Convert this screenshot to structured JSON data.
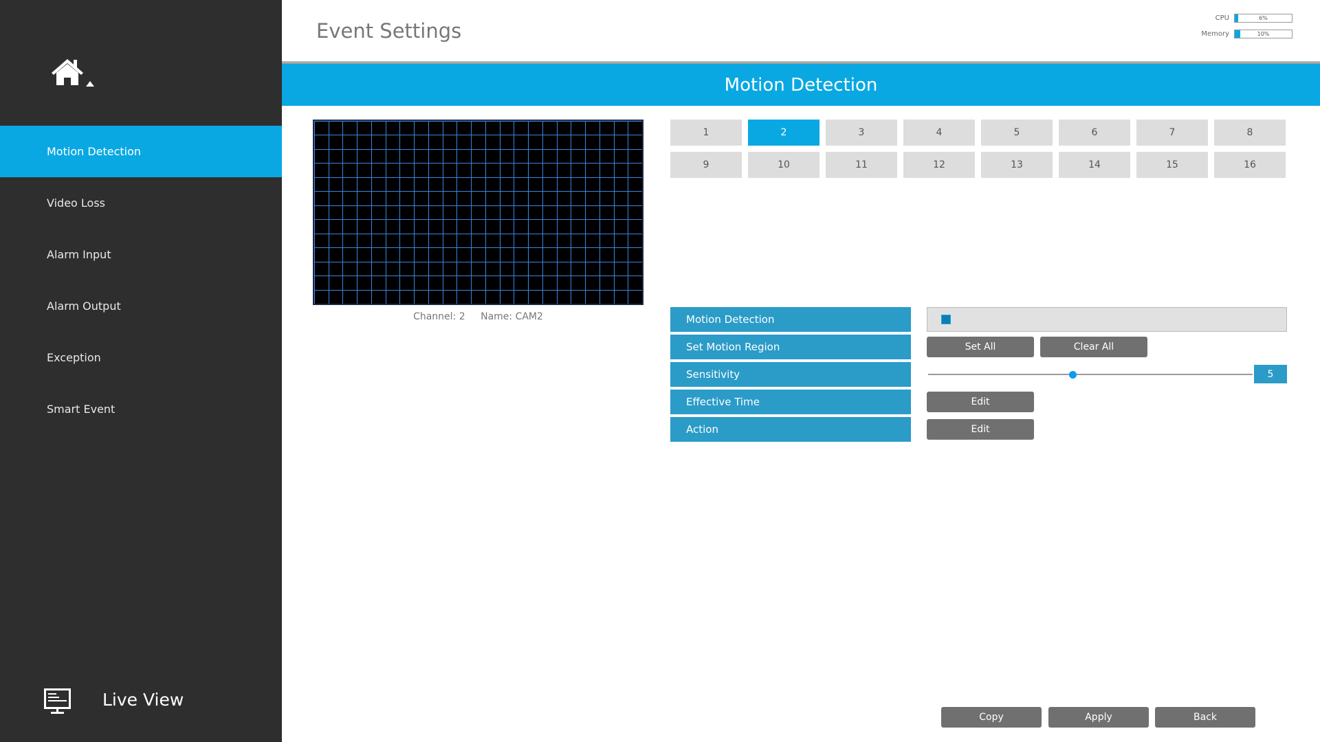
{
  "sidebar": {
    "home_icon": "home-icon",
    "items": [
      {
        "label": "Motion Detection",
        "active": true
      },
      {
        "label": "Video Loss",
        "active": false
      },
      {
        "label": "Alarm Input",
        "active": false
      },
      {
        "label": "Alarm Output",
        "active": false
      },
      {
        "label": "Exception",
        "active": false
      },
      {
        "label": "Smart Event",
        "active": false
      }
    ],
    "live_view": {
      "label": "Live View",
      "icon": "monitor-icon"
    }
  },
  "header": {
    "title": "Event Settings",
    "resources": {
      "cpu": {
        "label": "CPU",
        "value": "6%",
        "percent": 6
      },
      "memory": {
        "label": "Memory",
        "value": "10%",
        "percent": 10
      }
    }
  },
  "banner": {
    "title": "Motion Detection"
  },
  "preview": {
    "grid_columns": 23,
    "grid_rows": 13,
    "channel_label": "Channel: 2",
    "name_label": "Name: CAM2"
  },
  "channels": {
    "items": [
      "1",
      "2",
      "3",
      "4",
      "5",
      "6",
      "7",
      "8",
      "9",
      "10",
      "11",
      "12",
      "13",
      "14",
      "15",
      "16"
    ],
    "selected": "2"
  },
  "settings": {
    "rows": [
      {
        "label": "Motion Detection"
      },
      {
        "label": "Set Motion Region"
      },
      {
        "label": "Sensitivity"
      },
      {
        "label": "Effective Time"
      },
      {
        "label": "Action"
      }
    ],
    "motion_detection_enabled": true,
    "set_all_label": "Set All",
    "clear_all_label": "Clear All",
    "sensitivity": {
      "value": "5",
      "min": 1,
      "max": 10
    },
    "effective_time_edit_label": "Edit",
    "action_edit_label": "Edit"
  },
  "footer": {
    "copy_label": "Copy",
    "apply_label": "Apply",
    "back_label": "Back"
  },
  "colors": {
    "accent": "#0aa8e2",
    "label_blue": "#2b9bc8",
    "sidebar_bg": "#2e2e2e",
    "button_grey": "#707070",
    "grid_line": "#3a86e0"
  }
}
